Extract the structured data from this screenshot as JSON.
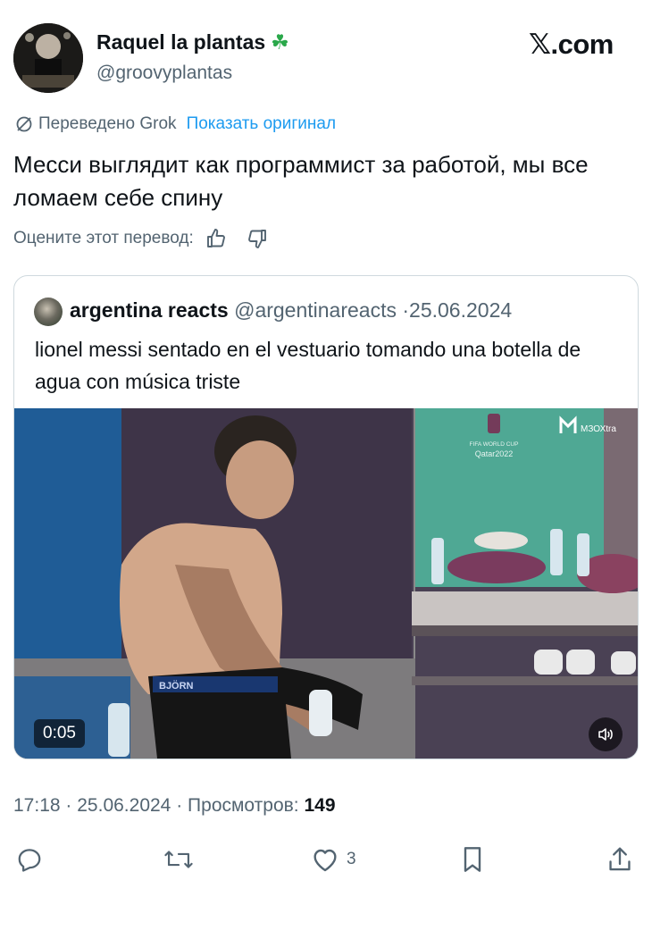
{
  "author": {
    "display_name": "Raquel la plantas",
    "emoji": "☘",
    "handle": "@groovyplantas"
  },
  "brand": {
    "prefix": "𝕏",
    "suffix": ".com"
  },
  "translation": {
    "translated_by": "Переведено Grok",
    "show_original": "Показать оригинал",
    "rate_label": "Оцените этот перевод:"
  },
  "tweet": {
    "text": " Месси выглядит как программист за работой, мы все ломаем себе спину"
  },
  "quoted": {
    "display_name": "argentina reacts",
    "handle": "@argentinareacts",
    "date": "25.06.2024",
    "text": "lionel messi sentado en el vestuario tomando una botella de agua con música triste",
    "video": {
      "duration": "0:05",
      "scene_texts": {
        "watermark": "МЗОХtra",
        "cup_line1": "FIFA WORLD CUP",
        "cup_line2": "Qatar2022",
        "shorts_brand": "BJÖRN"
      }
    }
  },
  "meta": {
    "time": "17:18",
    "date": "25.06.2024",
    "views_label": "Просмотров:",
    "views_count": "149"
  },
  "actions": {
    "like_count": "3"
  },
  "colors": {
    "accent": "#1d9bf0",
    "text": "#0f1419",
    "muted": "#536471",
    "border": "#cfd9de"
  }
}
